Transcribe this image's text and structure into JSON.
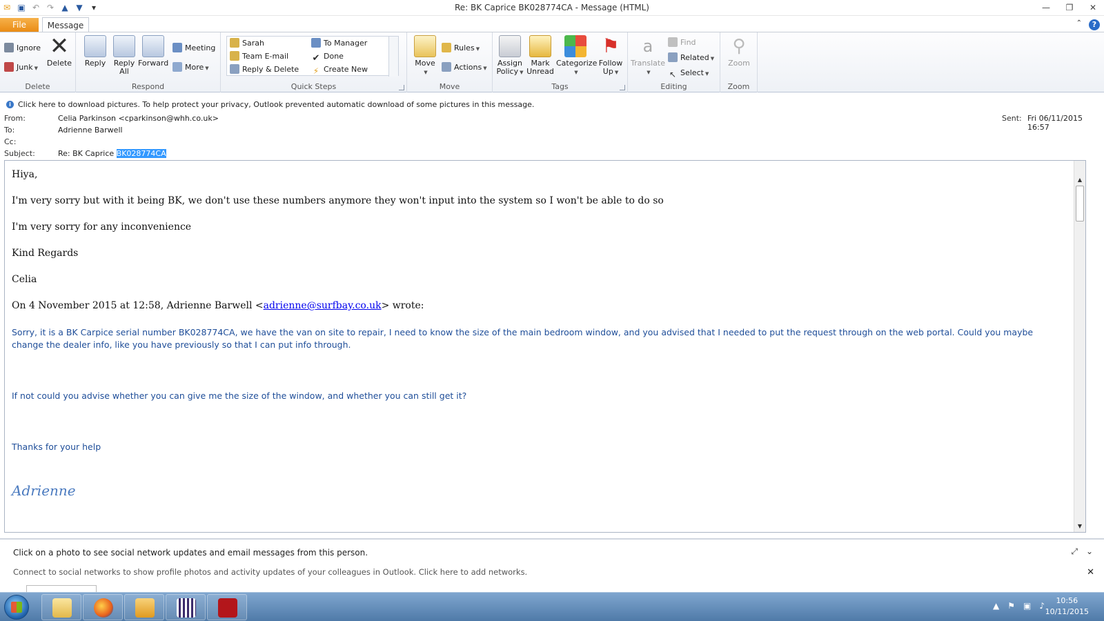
{
  "window": {
    "title": "Re: BK Caprice BK028774CA  -  Message (HTML)"
  },
  "tabs": {
    "file": "File",
    "message": "Message"
  },
  "ribbon": {
    "delete_group": {
      "label": "Delete",
      "ignore": "Ignore",
      "junk": "Junk",
      "delete": "Delete"
    },
    "respond_group": {
      "label": "Respond",
      "reply": "Reply",
      "reply_all_1": "Reply",
      "reply_all_2": "All",
      "forward": "Forward",
      "meeting": "Meeting",
      "more": "More"
    },
    "quicksteps_group": {
      "label": "Quick Steps",
      "items": [
        "Sarah",
        "Team E-mail",
        "Reply & Delete",
        "To Manager",
        "Done",
        "Create New"
      ]
    },
    "move_group": {
      "label": "Move",
      "move": "Move",
      "rules": "Rules",
      "actions": "Actions"
    },
    "tags_group": {
      "label": "Tags",
      "assign_1": "Assign",
      "assign_2": "Policy",
      "mark_1": "Mark",
      "mark_2": "Unread",
      "categorize": "Categorize",
      "follow_1": "Follow",
      "follow_2": "Up"
    },
    "editing_group": {
      "label": "Editing",
      "translate": "Translate",
      "find": "Find",
      "related": "Related",
      "select": "Select"
    },
    "zoom_group": {
      "label": "Zoom",
      "zoom": "Zoom"
    }
  },
  "header": {
    "infobar": "Click here to download pictures. To help protect your privacy, Outlook prevented automatic download of some pictures in this message.",
    "from_label": "From:",
    "from_value": "Celia Parkinson <cparkinson@whh.co.uk>",
    "to_label": "To:",
    "to_value": "Adrienne Barwell",
    "cc_label": "Cc:",
    "subject_label": "Subject:",
    "subject_prefix": "Re: BK Caprice ",
    "subject_selected": "BK028774CA",
    "sent_label": "Sent:",
    "sent_value": "Fri 06/11/2015 16:57"
  },
  "body": {
    "greeting": "Hiya,",
    "line1": "I'm very sorry but with it being BK, we don't use these numbers anymore they won't input into the system so I won't be able to do so",
    "line2": "I'm very sorry for any inconvenience",
    "regards": "Kind Regards",
    "name": "Celia",
    "wrote_prefix": "On 4 November 2015 at 12:58, Adrienne Barwell <",
    "wrote_email": "adrienne@surfbay.co.uk",
    "wrote_suffix": "> wrote:",
    "quote1": "Sorry, it is a BK Carpice  serial number BK028774CA, we have the van on site to repair, I need to know the size of the main bedroom window, and you advised that I needed to put the request through on the web portal.  Could you maybe change the dealer info, like you have previously so that I can put info through.",
    "quote2": "If not could you advise whether you can give me the size of the window, and whether you can still get it?",
    "quote3": "Thanks for your help",
    "signature": "Adrienne"
  },
  "people_pane": {
    "line1": "Click on a photo to see social network updates and email messages from this person.",
    "line2": "Connect to social networks to show profile photos and activity updates of your colleagues in Outlook. Click here to add networks."
  },
  "taskbar": {
    "time": "10:56",
    "date": "10/11/2015"
  }
}
